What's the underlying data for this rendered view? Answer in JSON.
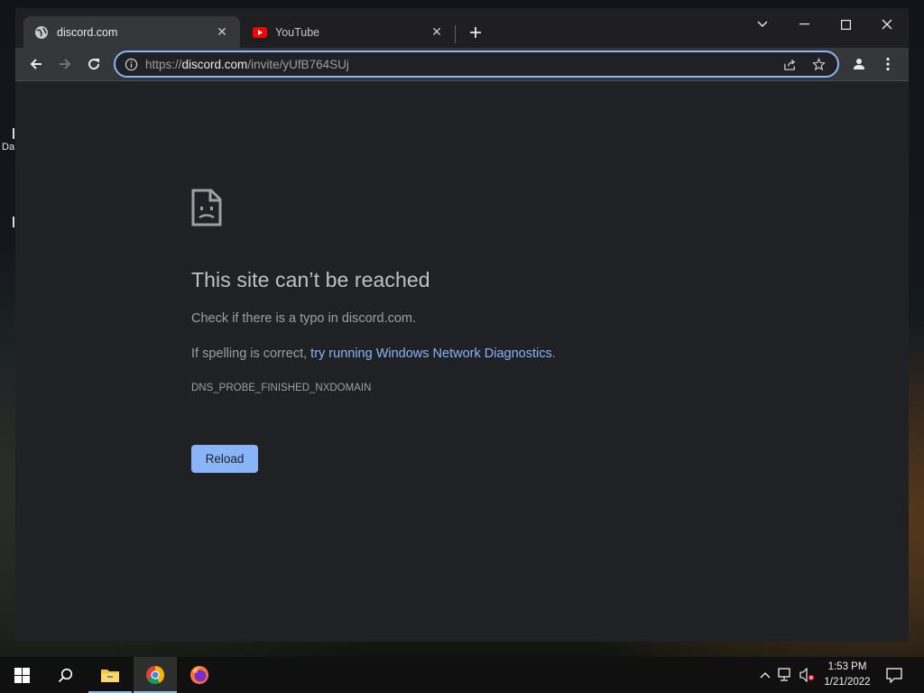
{
  "browser": {
    "tabs": [
      {
        "title": "discord.com",
        "icon": "globe-icon",
        "active": true
      },
      {
        "title": "YouTube",
        "icon": "youtube-icon",
        "active": false
      }
    ],
    "omnibox": {
      "scheme": "https://",
      "host": "discord.com",
      "path": "/invite/yUfB764SUj"
    }
  },
  "error_page": {
    "title": "This site can’t be reached",
    "line1": "Check if there is a typo in discord.com.",
    "line2_prefix": "If spelling is correct, ",
    "line2_link": "try running Windows Network Diagnostics",
    "line2_suffix": ".",
    "error_code": "DNS_PROBE_FINISHED_NXDOMAIN",
    "reload_label": "Reload"
  },
  "desktop": {
    "icon_label": "Da"
  },
  "taskbar": {
    "apps": [
      "start-icon",
      "search-icon",
      "file-explorer-icon",
      "chrome-icon",
      "firefox-icon"
    ],
    "clock_time": "1:53 PM",
    "clock_date": "1/21/2022"
  },
  "colors": {
    "accent": "#8ab4f8",
    "page_bg": "#202124",
    "toolbar_bg": "#35363a"
  }
}
